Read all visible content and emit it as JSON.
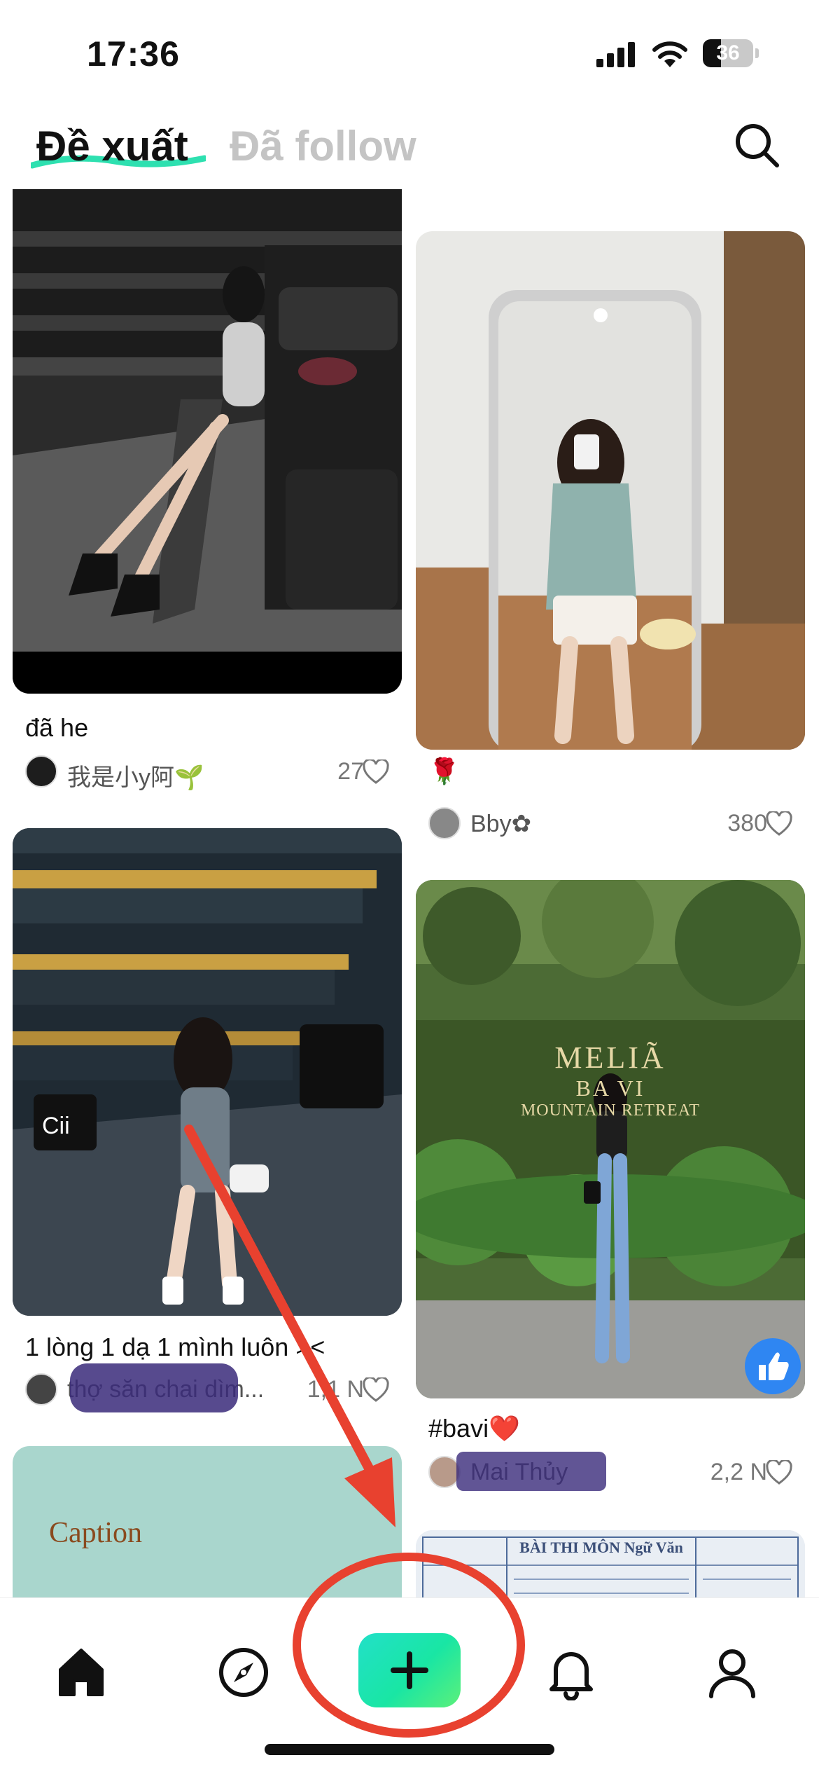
{
  "status_bar": {
    "time": "17:36",
    "battery_level": "36",
    "icons": [
      "signal-icon",
      "wifi-icon",
      "battery-icon"
    ]
  },
  "header": {
    "tabs": [
      {
        "label": "Đề xuất",
        "active": true
      },
      {
        "label": "Đã follow",
        "active": false
      }
    ],
    "search_icon": "search-icon",
    "accent_color": "#2ee0b0"
  },
  "feed": {
    "posts": [
      {
        "title": "đã he",
        "username": "我是小y阿🌱",
        "likes": "27"
      },
      {
        "title": "🌹",
        "username": "Bby✿",
        "likes": "380"
      },
      {
        "title": "1 lòng 1 dạ 1 mình luôn ><",
        "username": "thợ săn chai dìm...",
        "likes": "1,1 N"
      },
      {
        "title": "#bavi❤️",
        "username": "Mai Thủy",
        "likes": "2,2 N"
      },
      {
        "image_text": "Caption"
      },
      {
        "image_text": "BÀI THI MÔN Ngữ Văn"
      }
    ],
    "sign_text": [
      "MELIÃ",
      "BA VI",
      "MOUNTAIN RETREAT"
    ]
  },
  "bottom_nav": {
    "items": [
      "home-icon",
      "explore-icon",
      "create-button",
      "notifications-icon",
      "profile-icon"
    ],
    "create_gradient": [
      "#22e0c8",
      "#5cf07a"
    ]
  },
  "annotation": {
    "color": "#e8412f"
  }
}
